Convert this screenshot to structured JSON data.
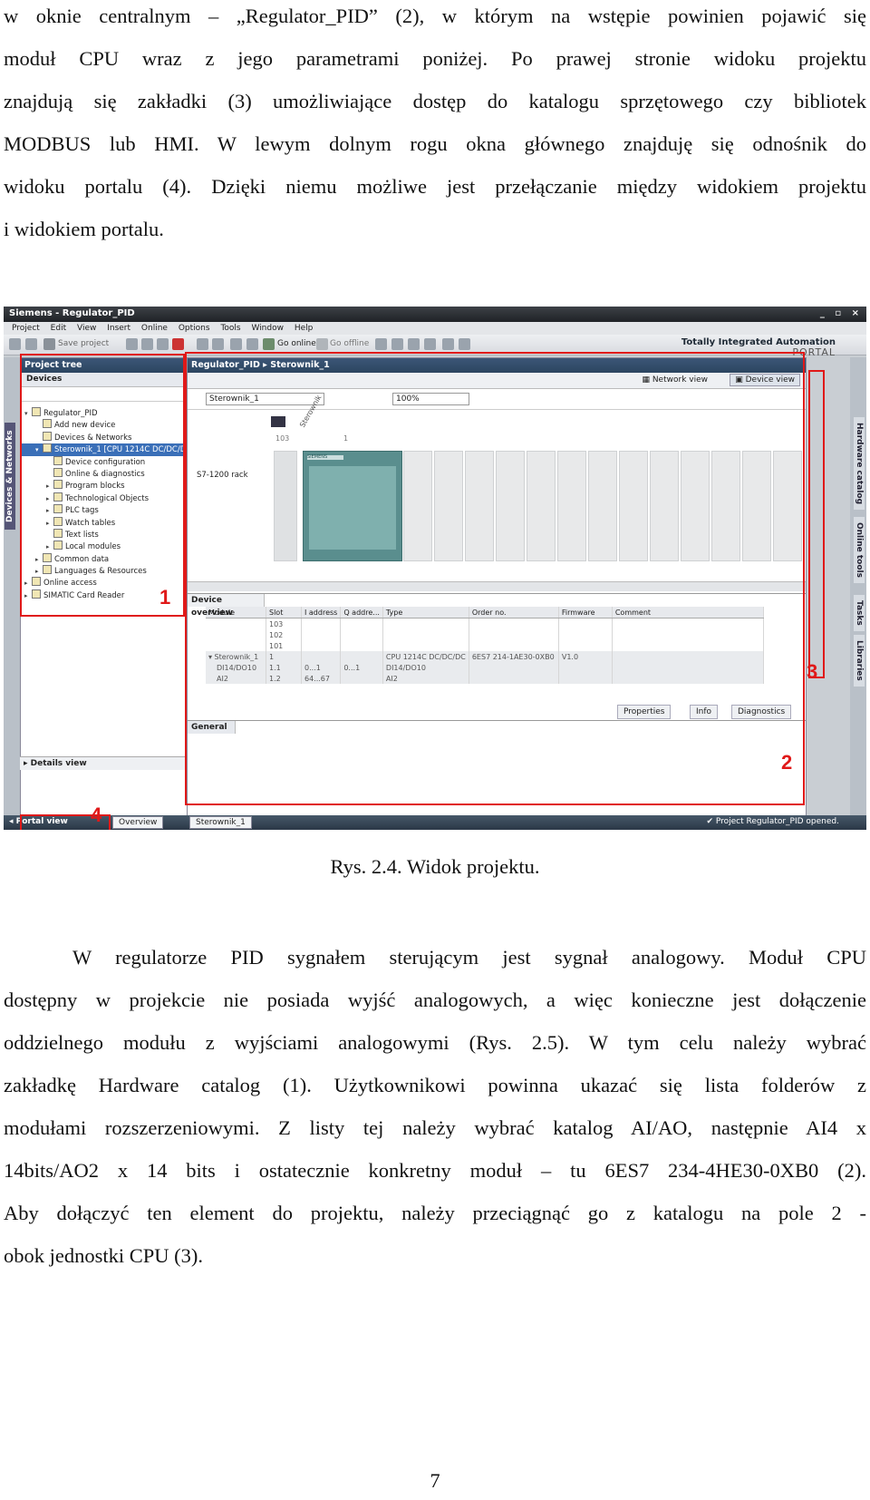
{
  "paragraph1": {
    "lines": [
      "w oknie centralnym – „Regulator_PID” (2), w którym na wstępie powinien pojawić się",
      "moduł CPU wraz z jego parametrami poniżej. Po prawej stronie widoku projektu",
      "znajdują się zakładki (3) umożliwiające dostęp do katalogu sprzętowego czy bibliotek",
      "MODBUS lub HMI. W lewym dolnym rogu okna głównego znajduję się odnośnik do",
      "widoku portalu (4). Dzięki niemu możliwe jest przełączanie między widokiem projektu",
      "i widokiem portalu."
    ]
  },
  "screenshot": {
    "title": "Siemens - Regulator_PID",
    "window_controls": "_ ▫ ×",
    "menu": [
      "Project",
      "Edit",
      "View",
      "Insert",
      "Online",
      "Options",
      "Tools",
      "Window",
      "Help"
    ],
    "toolbar": {
      "save_project": "Save project",
      "go_online": "Go online",
      "go_offline": "Go offline"
    },
    "tia_title": "Totally Integrated Automation",
    "tia_portal": "PORTAL",
    "left_vertical_tab": "Devices & Networks",
    "project_tree": {
      "title": "Project tree",
      "devices_header": "Devices",
      "items": [
        "Regulator_PID",
        "Add new device",
        "Devices & Networks",
        "Sterownik_1 [CPU 1214C DC/DC/DC]",
        "Device configuration",
        "Online & diagnostics",
        "Program blocks",
        "Technological Objects",
        "PLC tags",
        "Watch tables",
        "Text lists",
        "Local modules",
        "Common data",
        "Languages & Resources",
        "Online access",
        "SIMATIC Card Reader"
      ]
    },
    "work_area": {
      "breadcrumb": "Regulator_PID ▸ Sterownik_1",
      "network_view": "Network view",
      "device_view": "Device view",
      "device_select": "Sterownik_1",
      "zoom": "100%",
      "rack_label": "S7-1200 rack",
      "device_rotated_label": "Sterownik",
      "slot_labels": [
        "103",
        "1",
        "101",
        "103"
      ],
      "cpu_brand": "SIEMENS"
    },
    "device_overview": {
      "title": "Device overview",
      "columns": [
        "Module",
        "Slot",
        "I address",
        "Q addre...",
        "Type",
        "Order no.",
        "Firmware",
        "Comment"
      ],
      "rows": [
        [
          "",
          "103",
          "",
          "",
          "",
          "",
          "",
          ""
        ],
        [
          "",
          "102",
          "",
          "",
          "",
          "",
          "",
          ""
        ],
        [
          "",
          "101",
          "",
          "",
          "",
          "",
          "",
          ""
        ],
        [
          "▾ Sterownik_1",
          "1",
          "",
          "",
          "CPU 1214C DC/DC/DC",
          "6ES7 214-1AE30-0XB0",
          "V1.0",
          ""
        ],
        [
          "DI14/DO10",
          "1.1",
          "0...1",
          "0...1",
          "DI14/DO10",
          "",
          "",
          ""
        ],
        [
          "AI2",
          "1.2",
          "64...67",
          "",
          "AI2",
          "",
          "",
          ""
        ]
      ]
    },
    "property_tabs": [
      "Properties",
      "Info",
      "Diagnostics"
    ],
    "general_tab": "General",
    "right_tabs": [
      "Hardware catalog",
      "Online tools",
      "Tasks",
      "Libraries"
    ],
    "details_view": "Details view",
    "statusbar": {
      "portal_view": "Portal view",
      "overview": "Overview",
      "sterownik": "Sterownik_1",
      "message": "Project Regulator_PID opened."
    },
    "markers": [
      "1",
      "2",
      "3",
      "4"
    ]
  },
  "caption": "Rys. 2.4. Widok projektu.",
  "paragraph2": {
    "lines": [
      "W regulatorze PID sygnałem sterującym jest sygnał analogowy. Moduł CPU",
      "dostępny w projekcie nie posiada wyjść analogowych, a więc konieczne jest dołączenie",
      "oddzielnego modułu z wyjściami analogowymi (Rys. 2.5). W tym celu należy wybrać",
      "zakładkę Hardware catalog (1). Użytkownikowi powinna ukazać się lista folderów z",
      "modułami rozszerzeniowymi. Z listy tej należy wybrać katalog AI/AO, następnie AI4 x",
      "14bits/AO2 x 14 bits i ostatecznie konkretny moduł – tu 6ES7 234-4HE30-0XB0 (2).",
      "Aby dołączyć ten element do projektu, należy przeciągnąć go z katalogu na pole 2 -",
      "obok jednostki CPU (3)."
    ]
  },
  "page_number": "7"
}
